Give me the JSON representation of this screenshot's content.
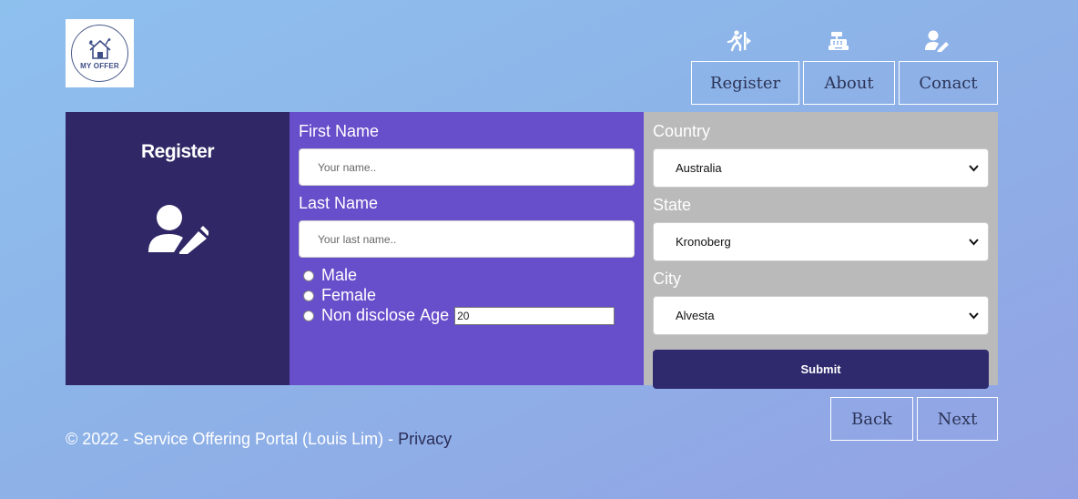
{
  "logo": {
    "text": "MY OFFER"
  },
  "nav": {
    "items": [
      {
        "label": "Register",
        "icon": "person-running-icon"
      },
      {
        "label": "About",
        "icon": "cash-register-icon"
      },
      {
        "label": "Conact",
        "icon": "user-edit-icon"
      }
    ]
  },
  "sidebar": {
    "title": "Register",
    "icon": "user-edit-icon"
  },
  "form": {
    "first_name_label": "First Name",
    "first_name_placeholder": "Your name..",
    "last_name_label": "Last Name",
    "last_name_placeholder": "Your last name..",
    "gender_options": [
      "Male",
      "Female",
      "Non disclose"
    ],
    "age_label": "Age",
    "age_value": "20",
    "country_label": "Country",
    "country_value": "Australia",
    "state_label": "State",
    "state_value": "Kronoberg",
    "city_label": "City",
    "city_value": "Alvesta",
    "submit_label": "Submit"
  },
  "pager": {
    "back_label": "Back",
    "next_label": "Next"
  },
  "footer": {
    "text": "© 2022 - Service Offering Portal (Louis Lim) - ",
    "privacy_label": "Privacy"
  },
  "colors": {
    "sidebar_bg": "#302766",
    "form_bg": "#674ecb",
    "right_bg": "#bababa",
    "submit_bg": "#2f2a6e"
  }
}
